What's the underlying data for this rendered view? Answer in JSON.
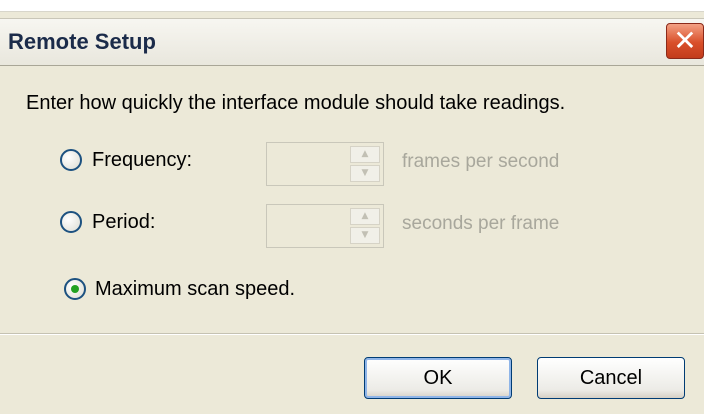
{
  "dialog": {
    "title": "Remote Setup",
    "close_icon": "close-icon",
    "instruction": "Enter how quickly the interface module should take readings."
  },
  "options": {
    "frequency": {
      "label": "Frequency:",
      "value": "",
      "unit": "frames per second",
      "selected": false
    },
    "period": {
      "label": "Period:",
      "value": "",
      "unit": "seconds per frame",
      "selected": false
    },
    "max_scan": {
      "label": "Maximum scan speed.",
      "selected": true
    }
  },
  "buttons": {
    "ok": "OK",
    "cancel": "Cancel"
  },
  "colors": {
    "radio_dot": "#21a121",
    "close_button": "#d94f2a",
    "disabled_text": "#a8a79c"
  }
}
